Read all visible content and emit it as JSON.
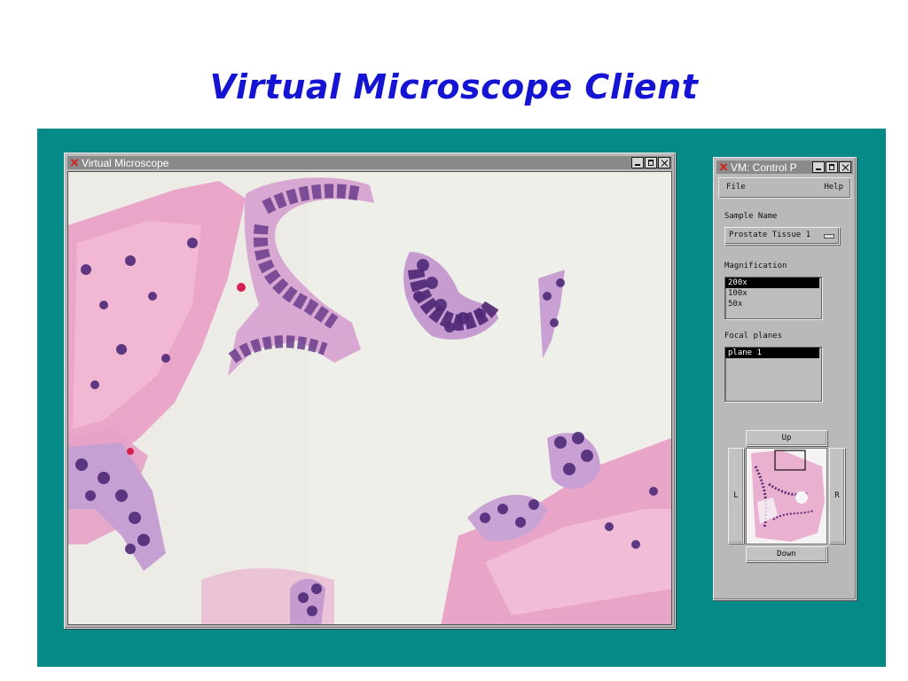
{
  "slide": {
    "title": "Virtual Microscope Client"
  },
  "main_window": {
    "title": "Virtual Microscope",
    "icon": "x-logo-icon",
    "buttons": [
      "minimize",
      "maximize",
      "close"
    ],
    "image": "prostate tissue micrograph"
  },
  "control_panel": {
    "title": "VM: Control P",
    "icon": "x-logo-icon",
    "menu": {
      "file": "File",
      "help": "Help"
    },
    "sample_name": {
      "label": "Sample Name",
      "value": "Prostate Tissue 1"
    },
    "magnification": {
      "label": "Magnification",
      "options": [
        "200x",
        "100x",
        "50x"
      ],
      "selected": "200x"
    },
    "focal_planes": {
      "label": "Focal planes",
      "options": [
        "plane 1"
      ],
      "selected": "plane 1"
    },
    "nav": {
      "up": "Up",
      "down": "Down",
      "left": "L",
      "right": "R"
    }
  },
  "colors": {
    "desktop": "#058a87",
    "title_text": "#1414d2",
    "stain_pink": "#e8a3c8",
    "stain_purple": "#5a2f7a"
  }
}
